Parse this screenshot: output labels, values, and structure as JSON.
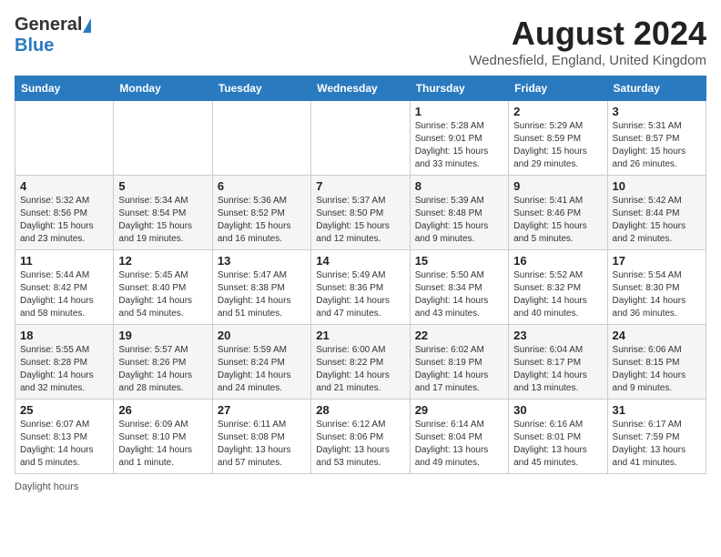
{
  "header": {
    "logo_general": "General",
    "logo_blue": "Blue",
    "month_year": "August 2024",
    "location": "Wednesfield, England, United Kingdom"
  },
  "footer": {
    "note": "Daylight hours"
  },
  "days_of_week": [
    "Sunday",
    "Monday",
    "Tuesday",
    "Wednesday",
    "Thursday",
    "Friday",
    "Saturday"
  ],
  "weeks": [
    [
      {
        "day": "",
        "info": ""
      },
      {
        "day": "",
        "info": ""
      },
      {
        "day": "",
        "info": ""
      },
      {
        "day": "",
        "info": ""
      },
      {
        "day": "1",
        "info": "Sunrise: 5:28 AM\nSunset: 9:01 PM\nDaylight: 15 hours\nand 33 minutes."
      },
      {
        "day": "2",
        "info": "Sunrise: 5:29 AM\nSunset: 8:59 PM\nDaylight: 15 hours\nand 29 minutes."
      },
      {
        "day": "3",
        "info": "Sunrise: 5:31 AM\nSunset: 8:57 PM\nDaylight: 15 hours\nand 26 minutes."
      }
    ],
    [
      {
        "day": "4",
        "info": "Sunrise: 5:32 AM\nSunset: 8:56 PM\nDaylight: 15 hours\nand 23 minutes."
      },
      {
        "day": "5",
        "info": "Sunrise: 5:34 AM\nSunset: 8:54 PM\nDaylight: 15 hours\nand 19 minutes."
      },
      {
        "day": "6",
        "info": "Sunrise: 5:36 AM\nSunset: 8:52 PM\nDaylight: 15 hours\nand 16 minutes."
      },
      {
        "day": "7",
        "info": "Sunrise: 5:37 AM\nSunset: 8:50 PM\nDaylight: 15 hours\nand 12 minutes."
      },
      {
        "day": "8",
        "info": "Sunrise: 5:39 AM\nSunset: 8:48 PM\nDaylight: 15 hours\nand 9 minutes."
      },
      {
        "day": "9",
        "info": "Sunrise: 5:41 AM\nSunset: 8:46 PM\nDaylight: 15 hours\nand 5 minutes."
      },
      {
        "day": "10",
        "info": "Sunrise: 5:42 AM\nSunset: 8:44 PM\nDaylight: 15 hours\nand 2 minutes."
      }
    ],
    [
      {
        "day": "11",
        "info": "Sunrise: 5:44 AM\nSunset: 8:42 PM\nDaylight: 14 hours\nand 58 minutes."
      },
      {
        "day": "12",
        "info": "Sunrise: 5:45 AM\nSunset: 8:40 PM\nDaylight: 14 hours\nand 54 minutes."
      },
      {
        "day": "13",
        "info": "Sunrise: 5:47 AM\nSunset: 8:38 PM\nDaylight: 14 hours\nand 51 minutes."
      },
      {
        "day": "14",
        "info": "Sunrise: 5:49 AM\nSunset: 8:36 PM\nDaylight: 14 hours\nand 47 minutes."
      },
      {
        "day": "15",
        "info": "Sunrise: 5:50 AM\nSunset: 8:34 PM\nDaylight: 14 hours\nand 43 minutes."
      },
      {
        "day": "16",
        "info": "Sunrise: 5:52 AM\nSunset: 8:32 PM\nDaylight: 14 hours\nand 40 minutes."
      },
      {
        "day": "17",
        "info": "Sunrise: 5:54 AM\nSunset: 8:30 PM\nDaylight: 14 hours\nand 36 minutes."
      }
    ],
    [
      {
        "day": "18",
        "info": "Sunrise: 5:55 AM\nSunset: 8:28 PM\nDaylight: 14 hours\nand 32 minutes."
      },
      {
        "day": "19",
        "info": "Sunrise: 5:57 AM\nSunset: 8:26 PM\nDaylight: 14 hours\nand 28 minutes."
      },
      {
        "day": "20",
        "info": "Sunrise: 5:59 AM\nSunset: 8:24 PM\nDaylight: 14 hours\nand 24 minutes."
      },
      {
        "day": "21",
        "info": "Sunrise: 6:00 AM\nSunset: 8:22 PM\nDaylight: 14 hours\nand 21 minutes."
      },
      {
        "day": "22",
        "info": "Sunrise: 6:02 AM\nSunset: 8:19 PM\nDaylight: 14 hours\nand 17 minutes."
      },
      {
        "day": "23",
        "info": "Sunrise: 6:04 AM\nSunset: 8:17 PM\nDaylight: 14 hours\nand 13 minutes."
      },
      {
        "day": "24",
        "info": "Sunrise: 6:06 AM\nSunset: 8:15 PM\nDaylight: 14 hours\nand 9 minutes."
      }
    ],
    [
      {
        "day": "25",
        "info": "Sunrise: 6:07 AM\nSunset: 8:13 PM\nDaylight: 14 hours\nand 5 minutes."
      },
      {
        "day": "26",
        "info": "Sunrise: 6:09 AM\nSunset: 8:10 PM\nDaylight: 14 hours\nand 1 minute."
      },
      {
        "day": "27",
        "info": "Sunrise: 6:11 AM\nSunset: 8:08 PM\nDaylight: 13 hours\nand 57 minutes."
      },
      {
        "day": "28",
        "info": "Sunrise: 6:12 AM\nSunset: 8:06 PM\nDaylight: 13 hours\nand 53 minutes."
      },
      {
        "day": "29",
        "info": "Sunrise: 6:14 AM\nSunset: 8:04 PM\nDaylight: 13 hours\nand 49 minutes."
      },
      {
        "day": "30",
        "info": "Sunrise: 6:16 AM\nSunset: 8:01 PM\nDaylight: 13 hours\nand 45 minutes."
      },
      {
        "day": "31",
        "info": "Sunrise: 6:17 AM\nSunset: 7:59 PM\nDaylight: 13 hours\nand 41 minutes."
      }
    ]
  ]
}
